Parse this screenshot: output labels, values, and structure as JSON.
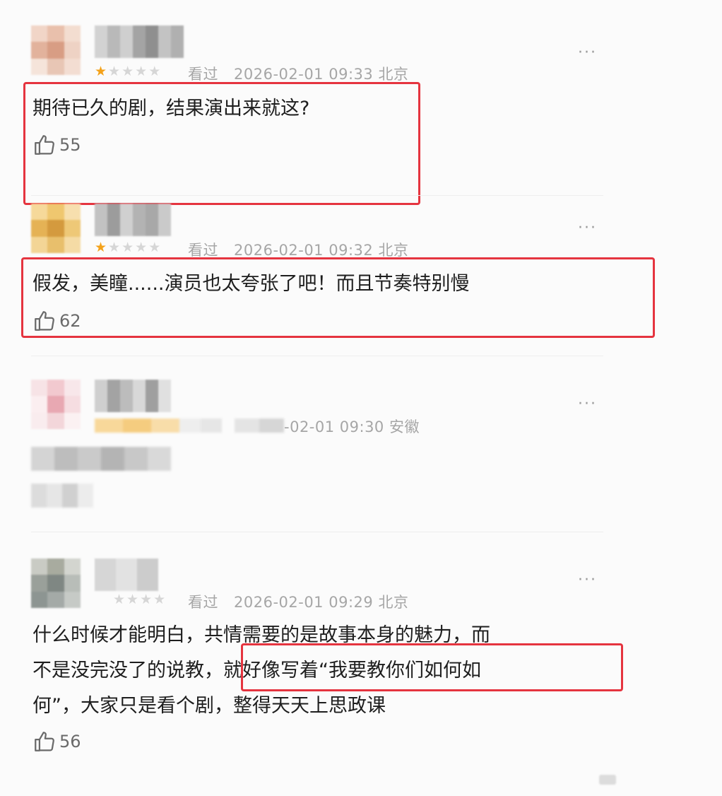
{
  "comments": [
    {
      "rating": 1,
      "watched": "看过",
      "time": "2026-02-01 09:33",
      "location": "北京",
      "text": "期待已久的剧，结果演出来就这?",
      "likes": "55",
      "more": "···"
    },
    {
      "rating": 1,
      "watched": "看过",
      "time": "2026-02-01 09:32",
      "location": "北京",
      "text": "假发，美瞳......演员也太夸张了吧！而且节奏特别慢",
      "likes": "62",
      "more": "···"
    },
    {
      "time_partial": "-02-01 09:30",
      "location": "安徽",
      "more": "···"
    },
    {
      "rating": 0,
      "watched": "看过",
      "time": "2026-02-01 09:29",
      "location": "北京",
      "text_line1": "什么时候才能明白，共情需要的是故事本身的魅力，而",
      "text_line2": "不是没完没了的说教，就好像写着“我要教你们如何如",
      "text_line3": "何”，大家只是看个剧，整得天天上思政课",
      "likes": "56",
      "more": "···"
    }
  ],
  "colors": {
    "highlight": "#e5343f",
    "star_on": "#f4a21a",
    "star_off": "#d6d6d6"
  }
}
